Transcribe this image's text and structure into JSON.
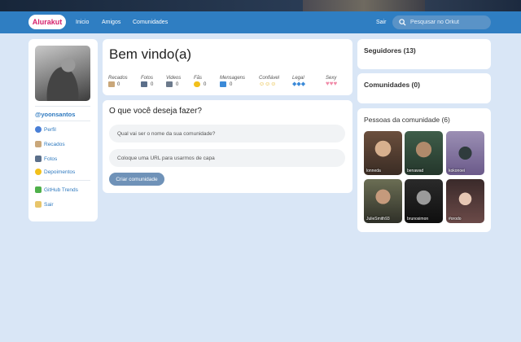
{
  "nav": {
    "logo": "Alurakut",
    "links": [
      "Inicio",
      "Amigos",
      "Comunidades"
    ],
    "logout": "Sair",
    "search_placeholder": "Pesquisar no Orkut"
  },
  "profile": {
    "username": "@yoonsantos",
    "menu": [
      "Perfil",
      "Recados",
      "Fotos",
      "Depoimentos",
      "GitHub Trends",
      "Sair"
    ]
  },
  "welcome": {
    "title": "Bem vindo(a)",
    "stats": [
      {
        "label": "Recados",
        "value": "0"
      },
      {
        "label": "Fotos",
        "value": "0"
      },
      {
        "label": "Videos",
        "value": "0"
      },
      {
        "label": "Fãs",
        "value": "0"
      },
      {
        "label": "Mensagens",
        "value": "0"
      },
      {
        "label": "Confiável",
        "value": ""
      },
      {
        "label": "Legal",
        "value": ""
      },
      {
        "label": "Sexy",
        "value": ""
      }
    ]
  },
  "action": {
    "title": "O que você deseja fazer?",
    "community_name_placeholder": "Qual vai ser o nome da sua comunidade?",
    "cover_url_placeholder": "Coloque uma URL para usarmos de capa",
    "create_button": "Criar comunidade"
  },
  "right": {
    "followers_title": "Seguidores (13)",
    "communities_title": "Comunidades (0)",
    "people_title": "Pessoas da comunidade (6)",
    "people": [
      "lonneda",
      "benawad",
      "kokonoei",
      "JulieSmith93",
      "brunosimon",
      "#orodo"
    ]
  },
  "colors": {
    "nav_bg": "#2f7ec2",
    "link": "#2e79bf",
    "logo_text": "#d5206b",
    "page_bg": "#d9e6f6"
  }
}
